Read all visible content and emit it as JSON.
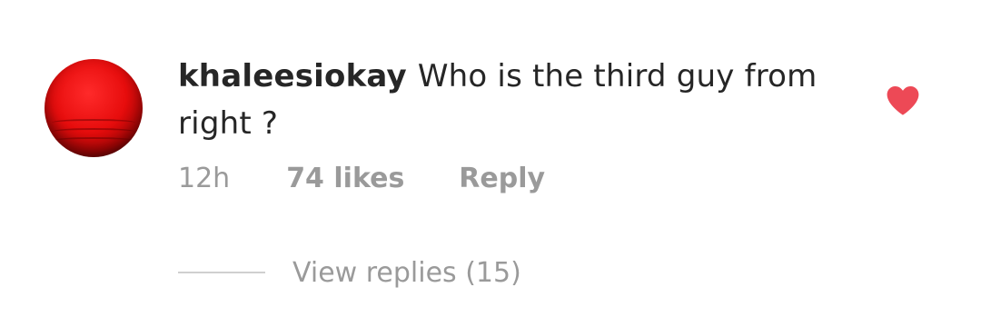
{
  "comment": {
    "username": "khaleesiokay",
    "text": "Who is the third guy from right ?",
    "time": "12h",
    "likes": "74 likes",
    "reply_label": "Reply",
    "liked": true,
    "heart_color": "#ed4956"
  },
  "replies": {
    "label": "View replies (15)"
  },
  "colors": {
    "text": "#262626",
    "muted": "#9a9a9a",
    "avatar": "#e70d0d"
  }
}
